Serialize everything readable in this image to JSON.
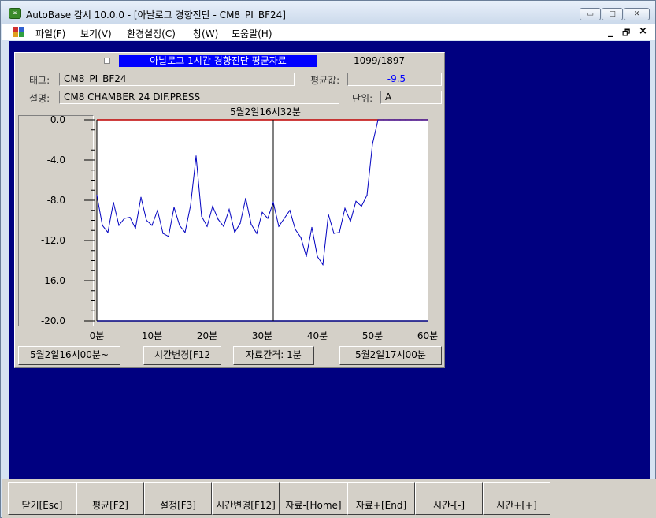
{
  "window": {
    "title": "AutoBase 감시 10.0.0 - [아날로그 경향진단 - CM8_PI_BF24]",
    "app_icon": "autobase-icon",
    "controls": [
      "minimize-icon",
      "maximize-icon",
      "close-icon"
    ]
  },
  "menu": {
    "items": [
      "파일(F)",
      "보기(V)",
      "환경설정(C)",
      "창(W)",
      "도움말(H)"
    ],
    "mdi_controls": [
      "_",
      "🗗",
      "×"
    ]
  },
  "panel": {
    "heading": "아날로그 1시간 경향진단 평균자료",
    "counter": "1099/1897",
    "tag_label": "태그:",
    "tag_value": "CM8_PI_BF24",
    "avg_label": "평균값:",
    "avg_value": "-9.5",
    "desc_label": "설명:",
    "desc_value": "CM8 CHAMBER 24 DIF.PRESS",
    "unit_label": "단위:",
    "unit_value": "A",
    "cursor_time": "5월2일16시32분",
    "start_time": "5월2일16시00분~",
    "change_time_btn": "시간변경[F12",
    "interval": "자료간격: 1분",
    "end_time": "5월2일17시00분"
  },
  "chart_data": {
    "type": "line",
    "xlabel": "",
    "ylabel": "",
    "x_ticks": [
      "0분",
      "10분",
      "20분",
      "30분",
      "40분",
      "50분",
      "60분"
    ],
    "y_ticks": [
      "0.0",
      "-4.0",
      "-8.0",
      "-12.0",
      "-16.0",
      "-20.0"
    ],
    "xlim": [
      0,
      60
    ],
    "ylim": [
      -20,
      0
    ],
    "cursor_x": 32,
    "reference_line_y": 0,
    "colors": {
      "series": "#0000c0",
      "reference": "#c00000",
      "cursor": "#000000"
    },
    "series": [
      {
        "x": [
          0,
          1,
          2,
          3,
          4,
          5,
          6,
          7,
          8,
          9,
          10,
          11,
          12,
          13,
          14,
          15,
          16,
          17,
          18,
          19,
          20,
          21,
          22,
          23,
          24,
          25,
          26,
          27,
          28,
          29,
          30,
          31,
          32,
          33,
          34,
          35,
          36,
          37,
          38,
          39,
          40,
          41,
          42,
          43,
          44,
          45,
          46,
          47,
          48,
          49,
          50,
          51,
          52,
          53,
          54,
          55,
          56,
          57,
          58,
          59,
          60
        ],
        "values": [
          -7.5,
          -10.5,
          -11.2,
          -8.2,
          -10.5,
          -9.8,
          -9.7,
          -10.8,
          -7.7,
          -10,
          -10.5,
          -9,
          -11.3,
          -11.6,
          -8.7,
          -10.5,
          -11.2,
          -8.5,
          -3.6,
          -9.6,
          -10.6,
          -8.6,
          -9.9,
          -10.6,
          -8.9,
          -11.2,
          -10.3,
          -7.8,
          -10.4,
          -11.3,
          -9.2,
          -9.8,
          -8.2,
          -10.6,
          -9.8,
          -9,
          -10.9,
          -11.7,
          -13.6,
          -10.7,
          -13.6,
          -14.4,
          -9.4,
          -11.3,
          -11.2,
          -8.8,
          -10.1,
          -8.1,
          -8.6,
          -7.5,
          -2.4,
          0,
          0,
          0,
          0,
          0,
          0,
          0,
          0,
          0,
          0
        ]
      }
    ]
  },
  "buttons": [
    "닫기[Esc]",
    "평균[F2]",
    "설정[F3]",
    "시간변경[F12]",
    "자료-[Home]",
    "자료+[End]",
    "시간-[-]",
    "시간+[+]"
  ]
}
